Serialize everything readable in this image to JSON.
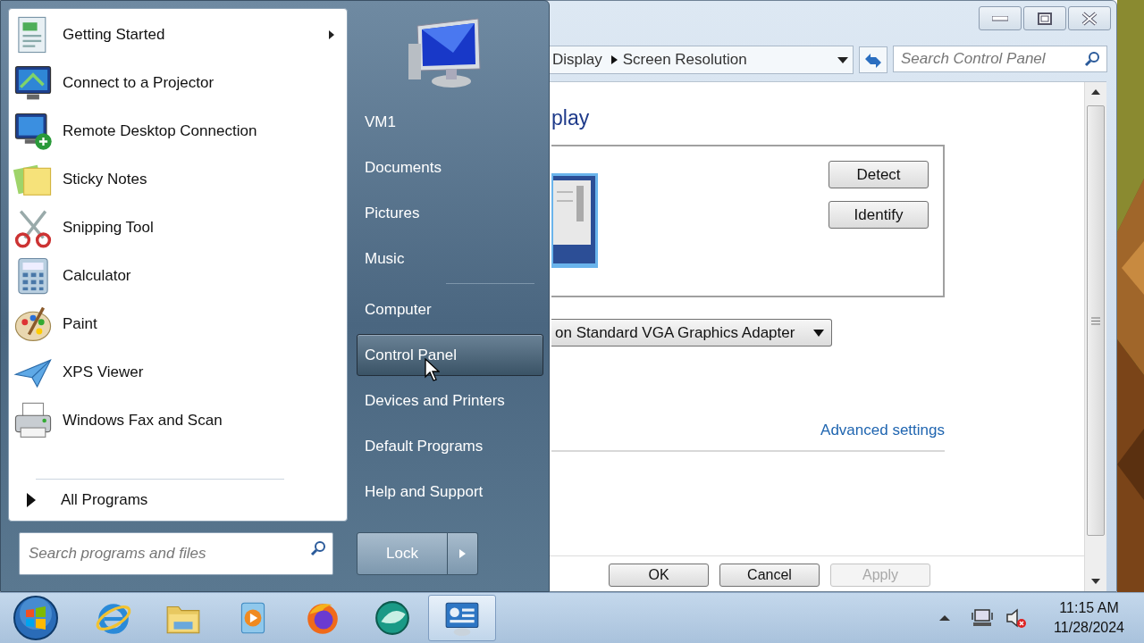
{
  "window": {
    "breadcrumb": [
      "Display",
      "Screen Resolution"
    ],
    "search": {
      "placeholder": "Search Control Panel"
    },
    "heading": "play",
    "side_buttons": [
      "Detect",
      "Identify"
    ],
    "display_dropdown": "on Standard VGA Graphics Adapter",
    "link": "Advanced settings",
    "dialog_buttons": [
      {
        "label": "OK",
        "disabled": false
      },
      {
        "label": "Cancel",
        "disabled": false
      },
      {
        "label": "Apply",
        "disabled": true
      }
    ]
  },
  "start_menu": {
    "programs": [
      {
        "label": "Getting Started",
        "kind": "document",
        "submenu": true
      },
      {
        "label": "Connect to a Projector",
        "kind": "projector",
        "submenu": false
      },
      {
        "label": "Remote Desktop Connection",
        "kind": "remote",
        "submenu": false
      },
      {
        "label": "Sticky Notes",
        "kind": "notes",
        "submenu": false
      },
      {
        "label": "Snipping Tool",
        "kind": "scissors",
        "submenu": false
      },
      {
        "label": "Calculator",
        "kind": "calculator",
        "submenu": false
      },
      {
        "label": "Paint",
        "kind": "palette",
        "submenu": false
      },
      {
        "label": "XPS Viewer",
        "kind": "plane",
        "submenu": false
      },
      {
        "label": "Windows Fax and Scan",
        "kind": "printer",
        "submenu": false
      }
    ],
    "all_programs": "All Programs",
    "search": {
      "placeholder": "Search programs and files"
    },
    "places": [
      [
        {
          "label": "VM1",
          "selected": false
        },
        {
          "label": "Documents",
          "selected": false
        },
        {
          "label": "Pictures",
          "selected": false
        },
        {
          "label": "Music",
          "selected": false
        }
      ],
      [
        {
          "label": "Computer",
          "selected": false
        },
        {
          "label": "Control Panel",
          "selected": true
        },
        {
          "label": "Devices and Printers",
          "selected": false
        },
        {
          "label": "Default Programs",
          "selected": false
        },
        {
          "label": "Help and Support",
          "selected": false
        }
      ]
    ],
    "lock": "Lock"
  },
  "taskbar": {
    "apps": [
      {
        "kind": "ie",
        "selected": false
      },
      {
        "kind": "folder",
        "selected": false
      },
      {
        "kind": "media",
        "selected": false
      },
      {
        "kind": "firefox",
        "selected": false
      },
      {
        "kind": "sphere",
        "selected": false
      },
      {
        "kind": "control",
        "selected": true
      }
    ],
    "clock": {
      "time": "11:15 AM",
      "date": "11/28/2024"
    }
  }
}
